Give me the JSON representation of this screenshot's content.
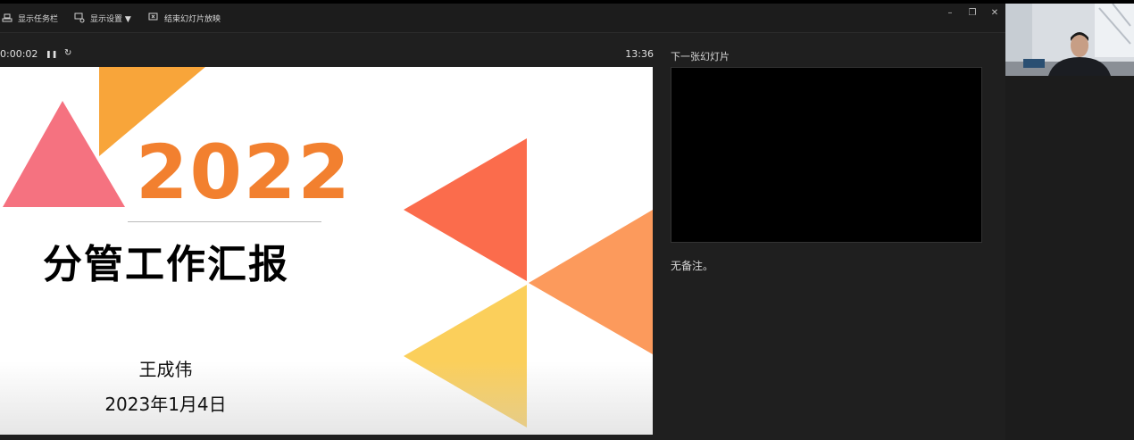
{
  "toolbar": {
    "show_taskbar": "显示任务栏",
    "display_settings": "显示设置 ▼",
    "end_show": "结束幻灯片放映"
  },
  "window_controls": {
    "minimize": "–",
    "restore": "❐",
    "close": "✕"
  },
  "timer": {
    "elapsed": "0:00:02",
    "pause": "❚❚",
    "reset": "↻",
    "clock": "13:36"
  },
  "slide": {
    "year": "2022",
    "title": "分管工作汇报",
    "presenter": "王成伟",
    "date": "2023年1月4日"
  },
  "next_slide": {
    "label": "下一张幻灯片"
  },
  "notes": {
    "text": "无备注。"
  },
  "icons": [
    "taskbar-icon",
    "monitor-settings-icon",
    "end-show-icon",
    "pause-icon",
    "reset-icon"
  ]
}
